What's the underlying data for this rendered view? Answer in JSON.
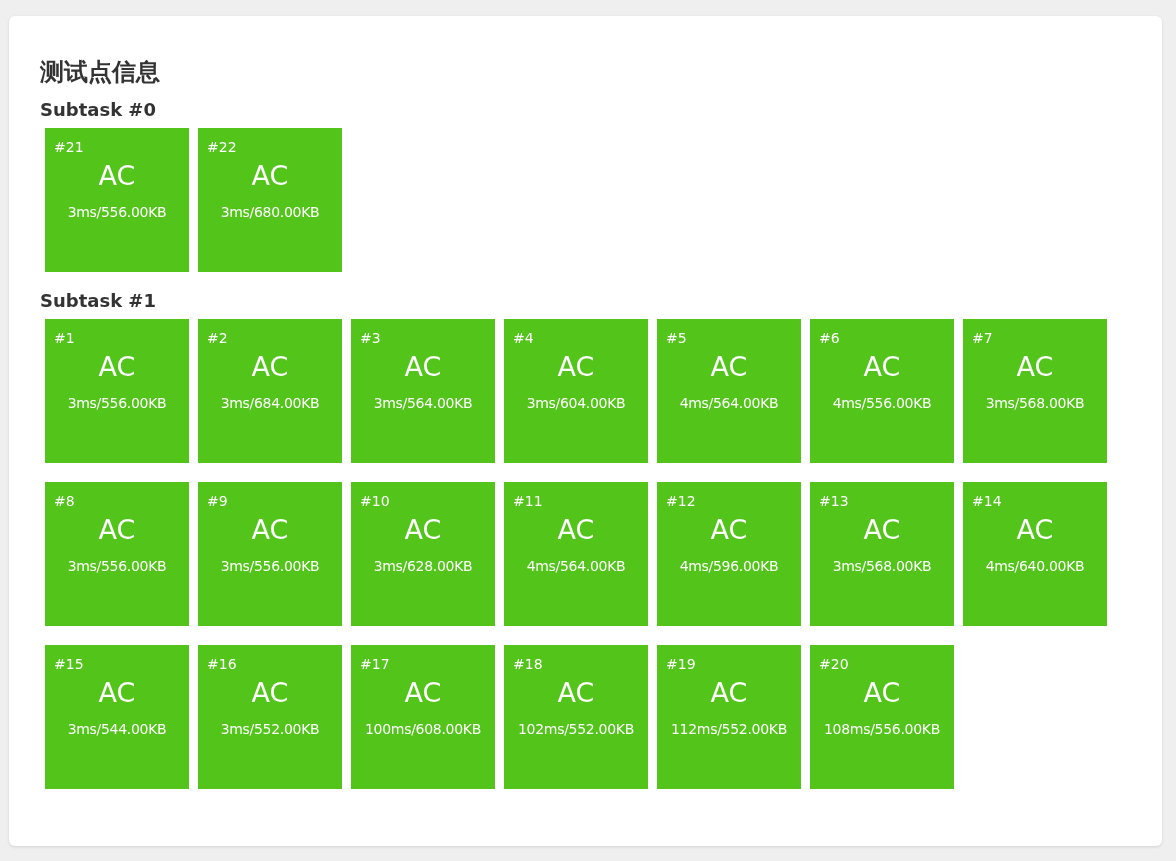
{
  "title": "测试点信息",
  "subtasks": [
    {
      "name": "Subtask #0",
      "cases": [
        {
          "id": "#21",
          "status": "AC",
          "info": "3ms/556.00KB"
        },
        {
          "id": "#22",
          "status": "AC",
          "info": "3ms/680.00KB"
        }
      ]
    },
    {
      "name": "Subtask #1",
      "cases": [
        {
          "id": "#1",
          "status": "AC",
          "info": "3ms/556.00KB"
        },
        {
          "id": "#2",
          "status": "AC",
          "info": "3ms/684.00KB"
        },
        {
          "id": "#3",
          "status": "AC",
          "info": "3ms/564.00KB"
        },
        {
          "id": "#4",
          "status": "AC",
          "info": "3ms/604.00KB"
        },
        {
          "id": "#5",
          "status": "AC",
          "info": "4ms/564.00KB"
        },
        {
          "id": "#6",
          "status": "AC",
          "info": "4ms/556.00KB"
        },
        {
          "id": "#7",
          "status": "AC",
          "info": "3ms/568.00KB"
        },
        {
          "id": "#8",
          "status": "AC",
          "info": "3ms/556.00KB"
        },
        {
          "id": "#9",
          "status": "AC",
          "info": "3ms/556.00KB"
        },
        {
          "id": "#10",
          "status": "AC",
          "info": "3ms/628.00KB"
        },
        {
          "id": "#11",
          "status": "AC",
          "info": "4ms/564.00KB"
        },
        {
          "id": "#12",
          "status": "AC",
          "info": "4ms/596.00KB"
        },
        {
          "id": "#13",
          "status": "AC",
          "info": "3ms/568.00KB"
        },
        {
          "id": "#14",
          "status": "AC",
          "info": "4ms/640.00KB"
        },
        {
          "id": "#15",
          "status": "AC",
          "info": "3ms/544.00KB"
        },
        {
          "id": "#16",
          "status": "AC",
          "info": "3ms/552.00KB"
        },
        {
          "id": "#17",
          "status": "AC",
          "info": "100ms/608.00KB"
        },
        {
          "id": "#18",
          "status": "AC",
          "info": "102ms/552.00KB"
        },
        {
          "id": "#19",
          "status": "AC",
          "info": "112ms/552.00KB"
        },
        {
          "id": "#20",
          "status": "AC",
          "info": "108ms/556.00KB"
        }
      ]
    }
  ]
}
